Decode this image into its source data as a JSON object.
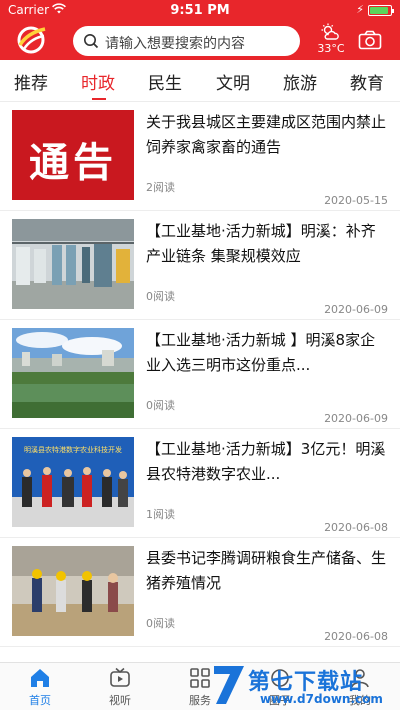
{
  "status_bar": {
    "carrier": "Carrier",
    "time": "9:51 PM",
    "battery_level": 0.9
  },
  "header": {
    "search_placeholder": "请输入想要搜索的内容",
    "temperature": "33°C",
    "icons": {
      "logo": "app-logo",
      "search": "search-icon",
      "weather": "partly-cloudy-icon",
      "camera": "camera-icon"
    },
    "accent": "#e8262b"
  },
  "tabs": [
    {
      "label": "推荐",
      "active": false
    },
    {
      "label": "时政",
      "active": true
    },
    {
      "label": "民生",
      "active": false
    },
    {
      "label": "文明",
      "active": false
    },
    {
      "label": "旅游",
      "active": false
    },
    {
      "label": "教育",
      "active": false
    }
  ],
  "news": [
    {
      "title": "关于我县城区主要建成区范围内禁止饲养家禽家畜的通告",
      "reads": "2阅读",
      "date": "2020-05-15",
      "thumb_text": "通告"
    },
    {
      "title": "【工业基地·活力新城】明溪：补齐产业链条 集聚规模效应",
      "reads": "0阅读",
      "date": "2020-06-09",
      "thumb_text": ""
    },
    {
      "title": "【工业基地·活力新城 】明溪8家企业入选三明市这份重点...",
      "reads": "0阅读",
      "date": "2020-06-09",
      "thumb_text": ""
    },
    {
      "title": "【工业基地·活力新城】3亿元！明溪县农特港数字农业...",
      "reads": "1阅读",
      "date": "2020-06-08",
      "thumb_text": "明溪县农特港数字农业科技开发"
    },
    {
      "title": "县委书记李腾调研粮食生产储备、生猪养殖情况",
      "reads": "0阅读",
      "date": "2020-06-08",
      "thumb_text": ""
    }
  ],
  "bottom_nav": [
    {
      "label": "首页",
      "icon": "home-icon",
      "active": true
    },
    {
      "label": "视听",
      "icon": "tv-icon",
      "active": false
    },
    {
      "label": "服务",
      "icon": "grid-icon",
      "active": false
    },
    {
      "label": "圈子",
      "icon": "circle-icon",
      "active": false
    },
    {
      "label": "我的",
      "icon": "user-icon",
      "active": false
    }
  ],
  "watermark": {
    "title": "第七下载站",
    "url": "www.d7down.com"
  }
}
